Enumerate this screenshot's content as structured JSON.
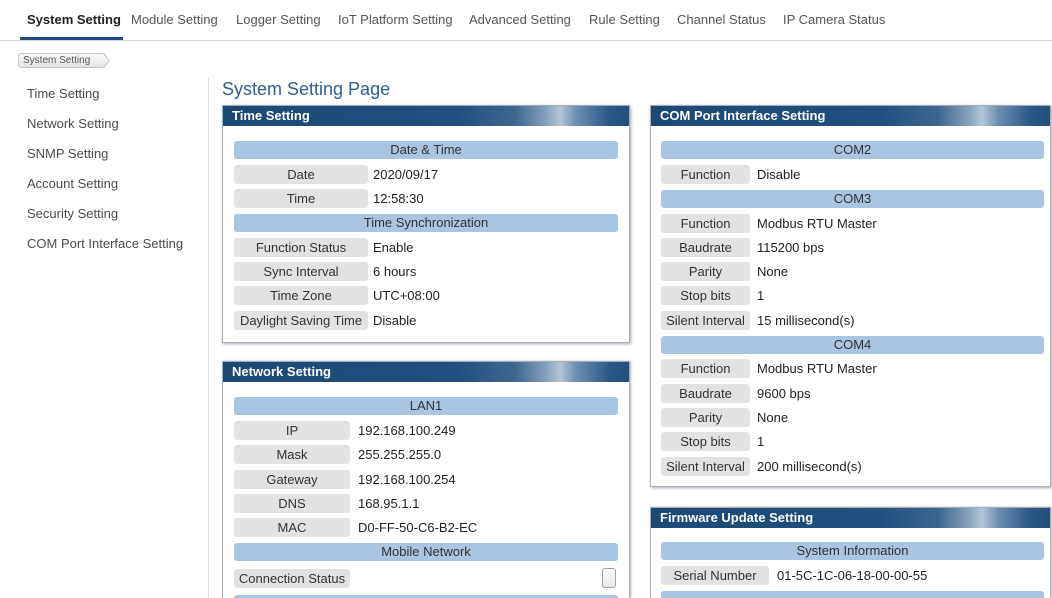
{
  "nav": {
    "tabs": [
      {
        "label": "System Setting",
        "active": true
      },
      {
        "label": "Module Setting"
      },
      {
        "label": "Logger Setting"
      },
      {
        "label": "IoT Platform Setting"
      },
      {
        "label": "Advanced Setting"
      },
      {
        "label": "Rule Setting"
      },
      {
        "label": "Channel Status"
      },
      {
        "label": "IP Camera Status"
      }
    ]
  },
  "breadcrumb": {
    "items": [
      "System Setting"
    ]
  },
  "sidebar": {
    "items": [
      "Time Setting",
      "Network Setting",
      "SNMP Setting",
      "Account Setting",
      "Security Setting",
      "COM Port Interface Setting"
    ]
  },
  "page_title": "System Setting Page",
  "time_panel": {
    "title": "Time Setting",
    "sections": [
      {
        "header": "Date & Time",
        "rows": [
          {
            "label": "Date",
            "value": "2020/09/17"
          },
          {
            "label": "Time",
            "value": "12:58:30"
          }
        ]
      },
      {
        "header": "Time Synchronization",
        "rows": [
          {
            "label": "Function Status",
            "value": "Enable"
          },
          {
            "label": "Sync Interval",
            "value": "6 hours"
          },
          {
            "label": "Time Zone",
            "value": "UTC+08:00"
          },
          {
            "label": "Daylight Saving Time",
            "value": "Disable"
          }
        ]
      }
    ]
  },
  "network_panel": {
    "title": "Network Setting",
    "sections": [
      {
        "header": "LAN1",
        "rows": [
          {
            "label": "IP",
            "value": "192.168.100.249"
          },
          {
            "label": "Mask",
            "value": "255.255.255.0"
          },
          {
            "label": "Gateway",
            "value": "192.168.100.254"
          },
          {
            "label": "DNS",
            "value": "168.95.1.1"
          },
          {
            "label": "MAC",
            "value": "D0-FF-50-C6-B2-EC"
          }
        ]
      },
      {
        "header": "Mobile Network",
        "rows": [
          {
            "label": "Connection Status"
          }
        ]
      }
    ]
  },
  "com_panel": {
    "title": "COM Port Interface Setting",
    "sections": [
      {
        "header": "COM2",
        "rows": [
          {
            "label": "Function",
            "value": "Disable"
          }
        ]
      },
      {
        "header": "COM3",
        "rows": [
          {
            "label": "Function",
            "value": "Modbus RTU Master"
          },
          {
            "label": "Baudrate",
            "value": "115200 bps"
          },
          {
            "label": "Parity",
            "value": "None"
          },
          {
            "label": "Stop bits",
            "value": "1"
          },
          {
            "label": "Silent Interval",
            "value": "15 millisecond(s)"
          }
        ]
      },
      {
        "header": "COM4",
        "rows": [
          {
            "label": "Function",
            "value": "Modbus RTU Master"
          },
          {
            "label": "Baudrate",
            "value": "9600 bps"
          },
          {
            "label": "Parity",
            "value": "None"
          },
          {
            "label": "Stop bits",
            "value": "1"
          },
          {
            "label": "Silent Interval",
            "value": "200 millisecond(s)"
          }
        ]
      }
    ]
  },
  "firmware_panel": {
    "title": "Firmware Update Setting",
    "sections": [
      {
        "header": "System Information",
        "rows": [
          {
            "label": "Serial Number",
            "value": "01-5C-1C-06-18-00-00-55"
          }
        ]
      }
    ]
  },
  "colors": {
    "accent": "#1f4f80",
    "title_text": "#2f5f91",
    "panel_header": "#1c4874",
    "section_bar": "#a8c5e4",
    "label_cell": "#e2e2e2"
  }
}
